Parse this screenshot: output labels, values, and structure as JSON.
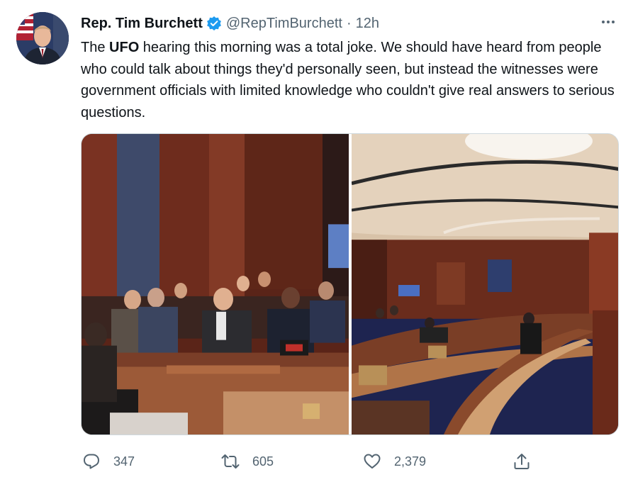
{
  "author": {
    "name": "Rep. Tim Burchett",
    "handle": "@RepTimBurchett",
    "separator": "·",
    "time": "12h",
    "verified": true,
    "verified_color": "#1d9bf0"
  },
  "tweet": {
    "text_before": "The ",
    "text_bold": "UFO",
    "text_after": " hearing this morning was a total joke. We should have heard from people who could talk about things they'd personally seen, but instead the witnesses were government officials with limited knowledge who couldn't give real answers to serious questions."
  },
  "media": [
    {
      "icon": "photo-hearing-room-witnesses"
    },
    {
      "icon": "photo-hearing-room-dais"
    }
  ],
  "actions": {
    "reply": {
      "icon": "reply-icon",
      "count": "347"
    },
    "retweet": {
      "icon": "retweet-icon",
      "count": "605"
    },
    "like": {
      "icon": "heart-icon",
      "count": "2,379"
    },
    "share": {
      "icon": "share-icon"
    }
  },
  "colors": {
    "text": "#0f1419",
    "secondary": "#536471",
    "border": "#cfd9de"
  }
}
